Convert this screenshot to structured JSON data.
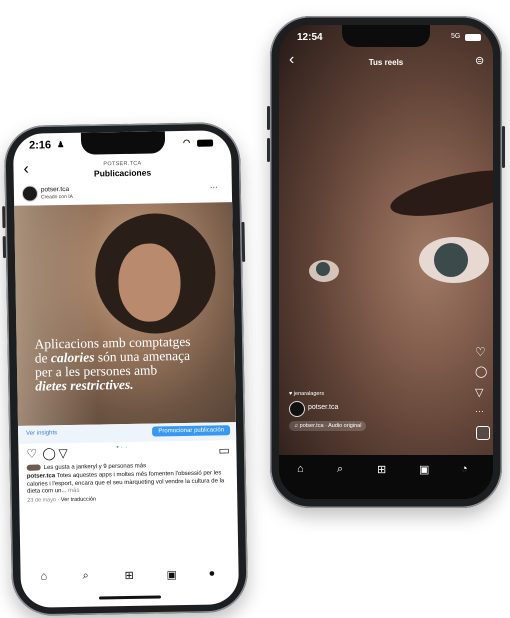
{
  "phone1": {
    "status_time": "2:16",
    "header": {
      "username": "POTSER.TCA",
      "title": "Publicaciones",
      "back": "‹"
    },
    "post": {
      "account": "potser.tca",
      "subtitle": "Creado con IA",
      "more": "···",
      "headline_1": "Aplicacions amb comptatges",
      "headline_2_pre": "de ",
      "headline_2_em": "calories",
      "headline_2_post": " són una amenaça",
      "headline_3": "per a les persones amb",
      "headline_4_em": "dietes restrictives.",
      "insights_label": "Ver insights",
      "boost_label": "Promocionar publicación",
      "likes_text": "Les gusta a jankeryl y 9 personas más",
      "caption_user": "potser.tca",
      "caption_text": "Totes aquestes apps i moltes més fomenten l'obsessió per les calories i l'esport, encara que el seu màrqueting vol vendre la cultura de la dieta com un...",
      "caption_more": "más",
      "date": "23 de mayo",
      "translation": "Ver traducción"
    },
    "nav": [
      "⌂",
      "⌕",
      "⊞",
      "▣",
      "●"
    ]
  },
  "phone2": {
    "status_time": "12:54",
    "status_net": "5G",
    "header": {
      "title": "Tus reels",
      "back": "‹"
    },
    "actions": [
      "♡",
      "◯",
      "▽",
      "···"
    ],
    "likes_text": "jenaralagers",
    "account": "potser.tca",
    "audio": "potser.tca · Audio original",
    "nav": [
      "⌂",
      "⌕",
      "⊞",
      "▣",
      "◔"
    ]
  }
}
